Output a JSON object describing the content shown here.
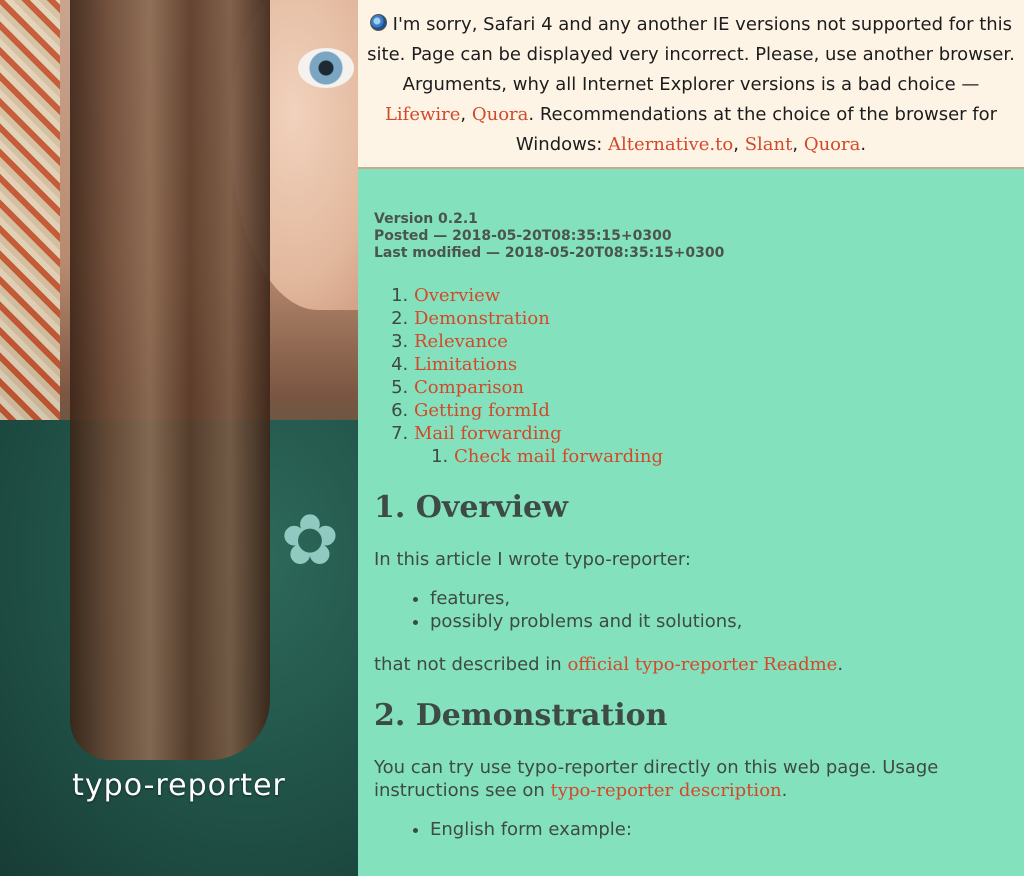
{
  "sidebar": {
    "site_title": "typo-reporter"
  },
  "notice": {
    "text_1": "I'm sorry, Safari 4 and any another IE versions not supported for this site. Page can be displayed very incorrect. Please, use another browser. Arguments, why all Internet Explorer versions is a bad choice —",
    "link_lifewire": "Lifewire",
    "sep_1": ",",
    "link_quora_1": "Quora",
    "text_2": ". Recommendations at the choice of the browser for Windows:",
    "link_alternative": "Alternative.to",
    "sep_2": ",",
    "link_slant": "Slant",
    "sep_3": ",",
    "link_quora_2": "Quora",
    "end": "."
  },
  "meta": {
    "version": "Version 0.2.1",
    "posted": "Posted — 2018-05-20T08:35:15+0300",
    "modified": "Last modified — 2018-05-20T08:35:15+0300"
  },
  "toc": {
    "items": [
      "Overview",
      "Demonstration",
      "Relevance",
      "Limitations",
      "Comparison",
      "Getting formId",
      "Mail forwarding"
    ],
    "sub_item": "Check mail forwarding"
  },
  "overview": {
    "heading": "1. Overview",
    "intro": "In this article I wrote typo-reporter:",
    "bullets": [
      "features,",
      "possibly problems and it solutions,"
    ],
    "outro_text": "that not described in",
    "outro_link": "official typo-reporter Readme",
    "outro_end": "."
  },
  "demonstration": {
    "heading": "2. Demonstration",
    "text": "You can try use typo-reporter directly on this web page. Usage instructions see on",
    "link": "typo-reporter description",
    "end": ".",
    "bullet": "English form example:"
  }
}
